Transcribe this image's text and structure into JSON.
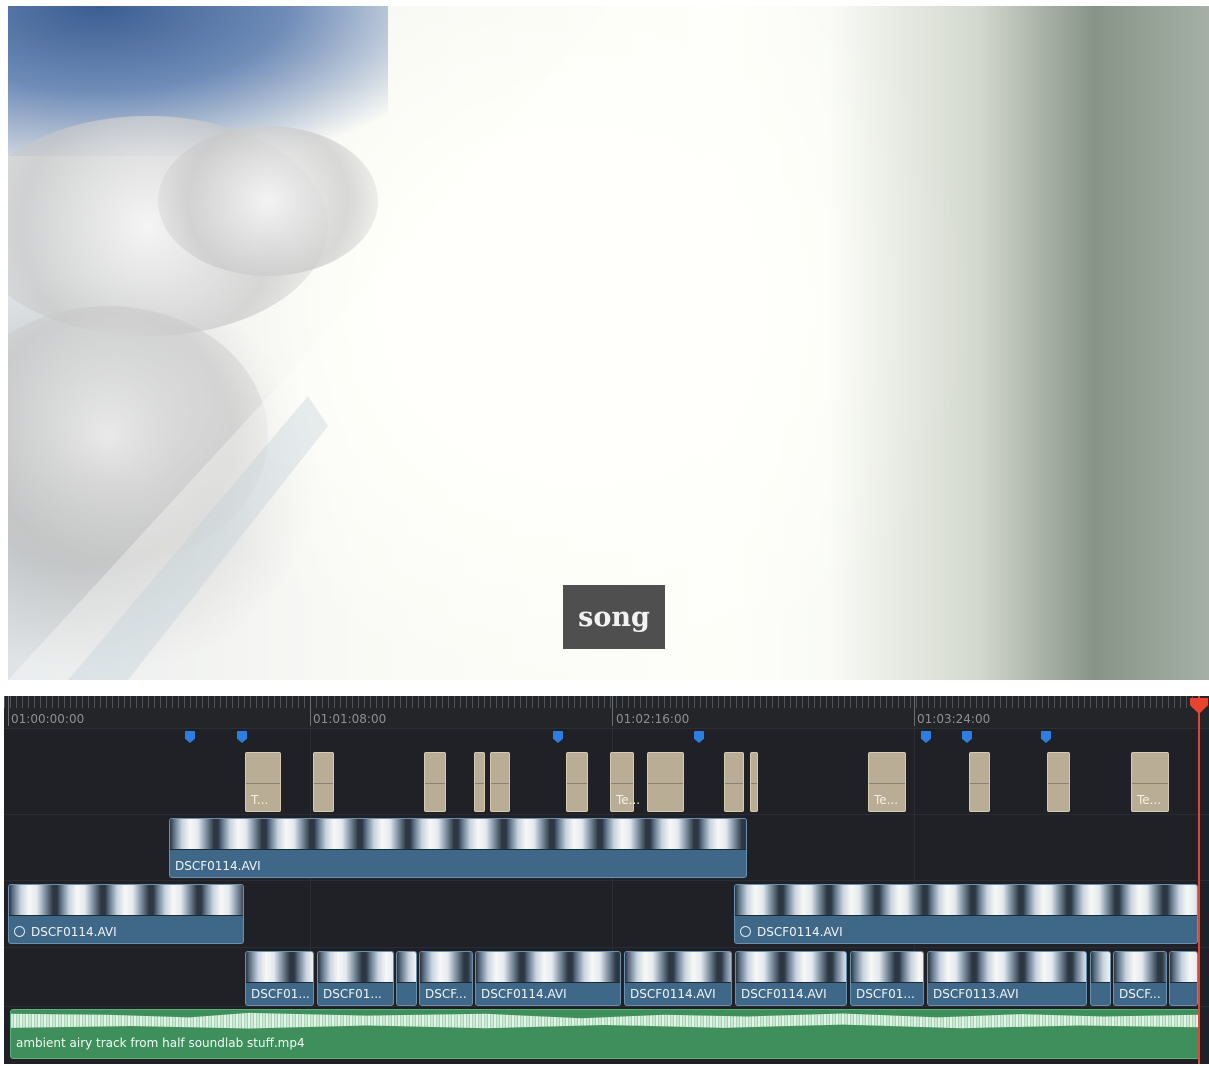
{
  "viewer": {
    "title_text": "song"
  },
  "timeline": {
    "ruler_timecodes": [
      "01:00:00:00",
      "01:01:08:00",
      "01:02:16:00",
      "01:03:24:00"
    ],
    "marker_color": "#2f7de0",
    "title_clips": [
      "T...",
      "",
      "",
      "",
      "",
      "",
      "Te...",
      "",
      "",
      "Te...",
      "",
      "",
      "Te..."
    ],
    "video_track_3": {
      "clip_label": "DSCF0114.AVI"
    },
    "video_track_2": {
      "clip_left_label": "DSCF0114.AVI",
      "clip_right_label": "DSCF0114.AVI"
    },
    "video_track_1": {
      "clips": [
        "DSCF01...",
        "DSCF01...",
        "",
        "DSCF...",
        "DSCF0114.AVI",
        "DSCF0114.AVI",
        "DSCF0114.AVI",
        "DSCF01...",
        "DSCF0113.AVI",
        "",
        "DSCF...",
        ""
      ]
    },
    "audio_track": {
      "clip_label": "ambient airy track from half soundlab stuff.mp4"
    },
    "playhead_color": "#e8432f"
  }
}
